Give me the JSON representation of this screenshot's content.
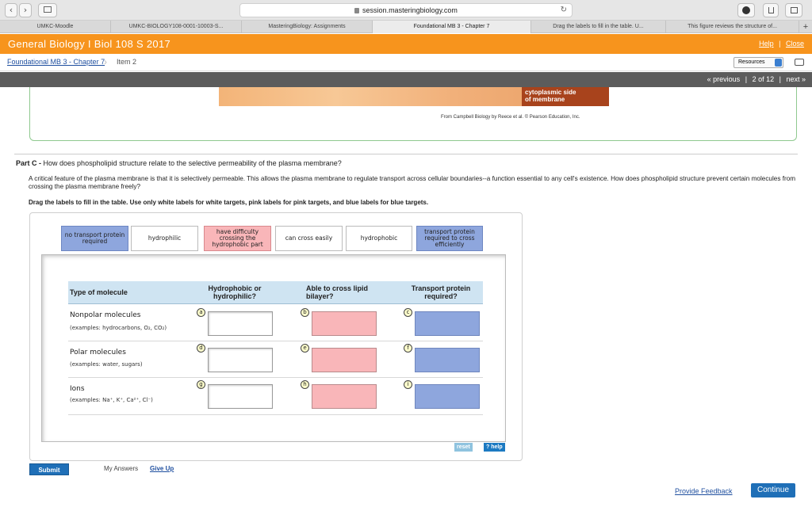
{
  "browser": {
    "url": "session.masteringbiology.com",
    "tabs": [
      {
        "label": "UMKC-Moodle"
      },
      {
        "label": "UMKC-BIOLOGY108-0001-10003-S..."
      },
      {
        "label": "MasteringBiology: Assignments"
      },
      {
        "label": "Foundational MB 3 - Chapter 7"
      },
      {
        "label": "Drag the labels to fill in the table. U..."
      },
      {
        "label": "This figure reviews the structure of..."
      }
    ],
    "new_tab": "+"
  },
  "course": {
    "title": "General Biology I Biol 108 S 2017",
    "help": "Help",
    "close": "Close",
    "separator": "|"
  },
  "breadcrumb": {
    "parent": "Foundational MB 3 - Chapter 7",
    "current": "Item 2",
    "resources": "Resources"
  },
  "pager": {
    "previous": "« previous",
    "position": "2 of 12",
    "next": "next »",
    "separator": "|"
  },
  "figure": {
    "label_line1": "cytoplasmic side",
    "label_line2": "of membrane",
    "credit": "From Campbell Biology by Reece et al. © Pearson Education, Inc."
  },
  "question": {
    "part": "Part C -",
    "title": "How does phospholipid structure relate to the selective permeability of the plasma membrane?",
    "intro": "A critical feature of the plasma membrane is that it is selectively permeable. This allows the plasma membrane to regulate transport across cellular boundaries--a function essential to any cell's existence. How does phospholipid structure prevent certain molecules from crossing the plasma membrane freely?",
    "instructions": "Drag the labels to fill in the table. Use only white labels for white targets, pink labels for pink targets, and blue labels for blue targets."
  },
  "labels": [
    {
      "text": "no transport protein required",
      "color": "blue"
    },
    {
      "text": "hydrophilic",
      "color": "white"
    },
    {
      "text": "have difficulty crossing the hydrophobic part",
      "color": "pink"
    },
    {
      "text": "can cross easily",
      "color": "pink"
    },
    {
      "text": "hydrophobic",
      "color": "white"
    },
    {
      "text": "transport protein required to cross efficiently",
      "color": "blue"
    }
  ],
  "table": {
    "headers": [
      "Type of molecule",
      "Hydrophobic or hydrophilic?",
      "Able to cross lipid bilayer?",
      "Transport protein required?"
    ],
    "rows": [
      {
        "name": "Nonpolar molecules",
        "examples": "(examples: hydrocarbons, O₂, CO₂)",
        "letters": [
          "a",
          "b",
          "c"
        ]
      },
      {
        "name": "Polar molecules",
        "examples": "(examples: water, sugars)",
        "letters": [
          "d",
          "e",
          "f"
        ]
      },
      {
        "name": "Ions",
        "examples": "(examples: Na⁺, K⁺, Ca²⁺, Cl⁻)",
        "letters": [
          "g",
          "h",
          "i"
        ]
      }
    ]
  },
  "controls": {
    "reset": "reset",
    "help": "? help",
    "submit": "Submit",
    "my_answers": "My Answers",
    "give_up": "Give Up",
    "feedback": "Provide Feedback",
    "continue": "Continue"
  },
  "colors": {
    "orange_header": "#f7941d",
    "white_target": "#ffffff",
    "pink_target": "#f9b6b9",
    "blue_target": "#8ea6dd",
    "primary_button": "#1f6fb7"
  }
}
